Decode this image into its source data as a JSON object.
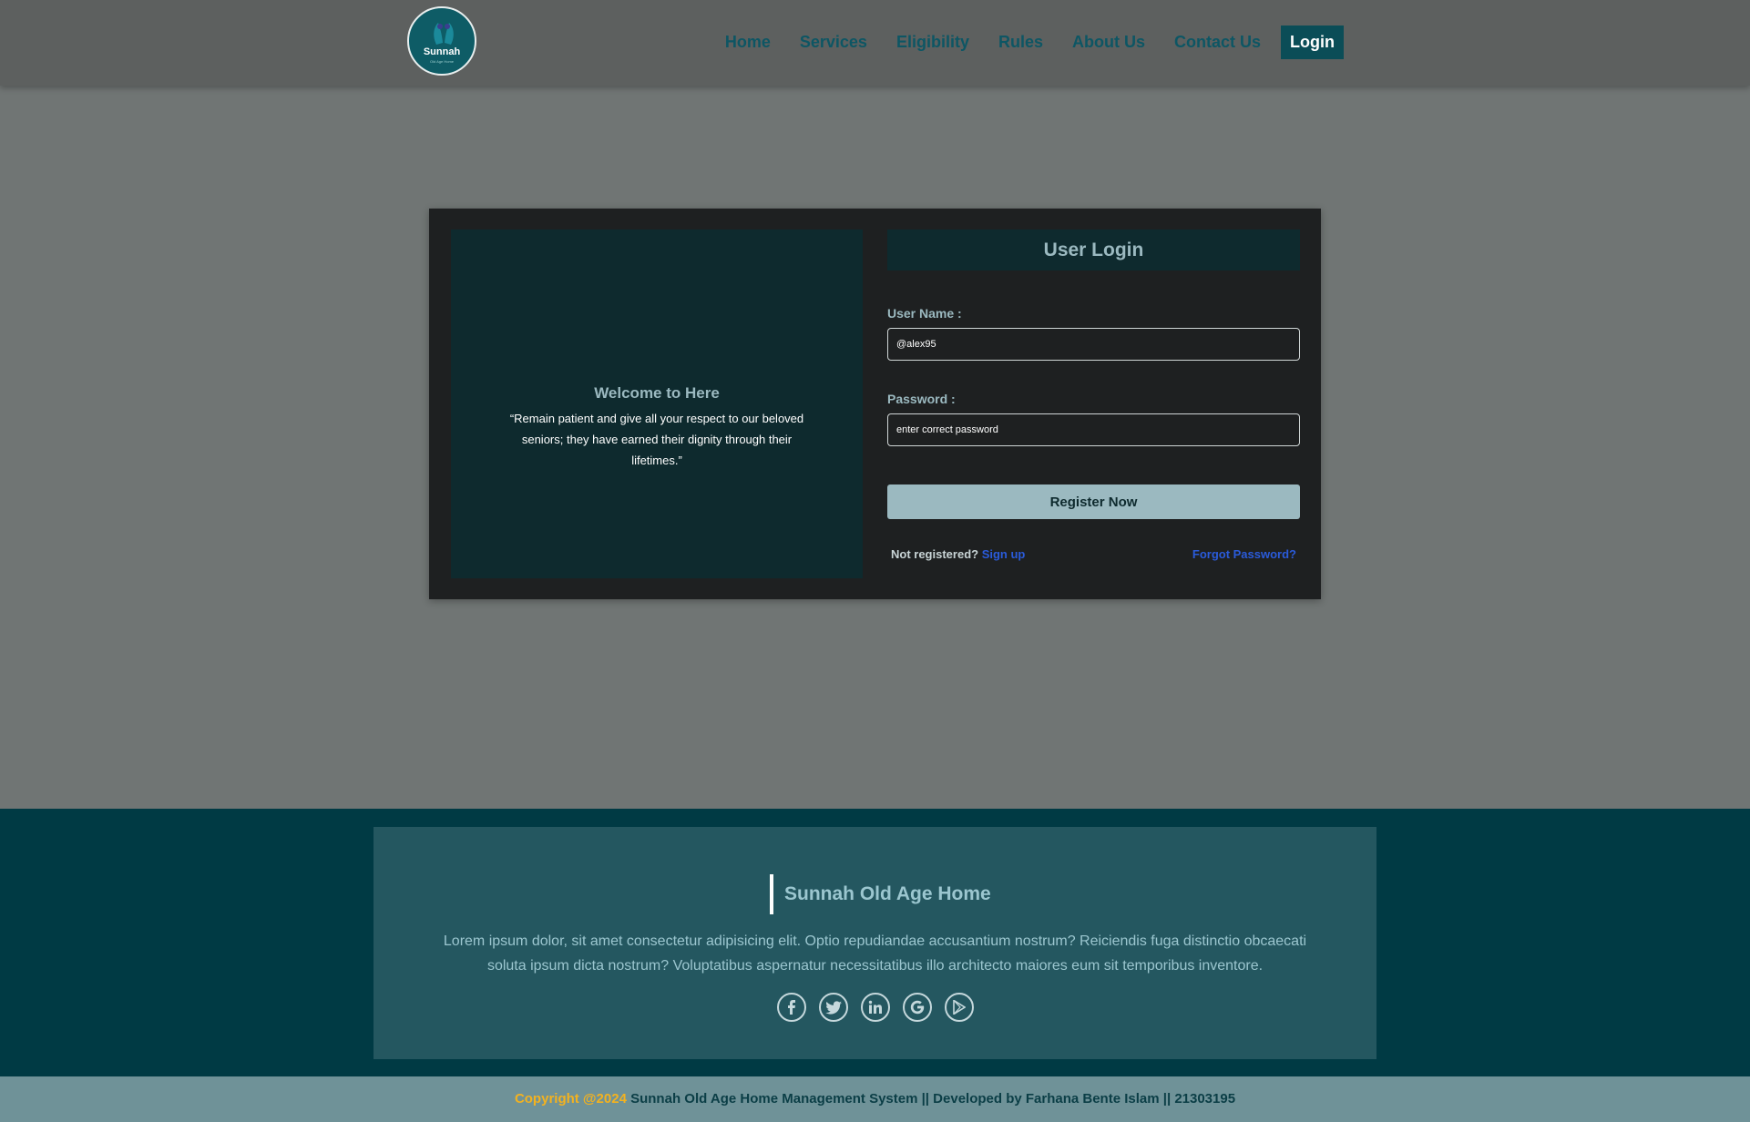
{
  "brand": {
    "logo_text": "Sunnah",
    "logo_sub": "Old Age Home"
  },
  "nav": {
    "items": [
      "Home",
      "Services",
      "Eligibility",
      "Rules",
      "About Us",
      "Contact Us"
    ],
    "login": "Login"
  },
  "welcome": {
    "title": "Welcome to Here",
    "quote": "“Remain patient and give all your respect to our beloved seniors; they have earned their dignity through their lifetimes.”"
  },
  "login_form": {
    "title": "User Login",
    "username_label": "User Name :",
    "username_value": "@alex95",
    "password_label": "Password :",
    "password_placeholder": "enter correct password",
    "submit_label": "Register Now",
    "not_registered": "Not registered?",
    "signup_link": "Sign up",
    "forgot_link": "Forgot Password?"
  },
  "footer": {
    "title": "Sunnah Old Age Home",
    "text": "Lorem ipsum dolor, sit amet consectetur adipisicing elit. Optio repudiandae accusantium nostrum? Reiciendis fuga distinctio obcaecati soluta ipsum dicta nostrum? Voluptatibus aspernatur necessitatibus illo architecto maiores eum sit temporibus inventore.",
    "socials": [
      "facebook-icon",
      "twitter-icon",
      "linkedin-icon",
      "google-icon",
      "google-play-icon"
    ]
  },
  "copyright": {
    "year_text": "Copyright @2024",
    "rest": " Sunnah Old Age Home Management System || Developed by Farhana Bente Islam || 21303195"
  },
  "colors": {
    "nav_bg": "#5d605f",
    "page_bg": "#707574",
    "accent": "#0b4d57",
    "card_bg": "#1e2021",
    "panel_bg": "#0e2a2e",
    "footer_bg": "#003a44",
    "copyright_accent": "#f3b21f"
  }
}
